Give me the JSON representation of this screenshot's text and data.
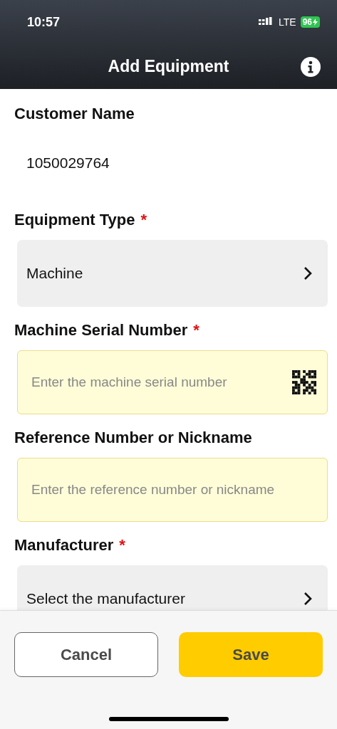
{
  "status_bar": {
    "time": "10:57",
    "network": "LTE",
    "battery": "96"
  },
  "header": {
    "title": "Add Equipment"
  },
  "fields": [
    {
      "kind": "text",
      "label": "Customer Name",
      "value": "1050029764"
    },
    {
      "kind": "select",
      "label": "Equipment Type",
      "required_mark": "*",
      "value": "Machine"
    },
    {
      "kind": "input",
      "label": "Machine Serial Number",
      "required_mark": "*",
      "placeholder": "Enter the machine serial number",
      "scan": true
    },
    {
      "kind": "input",
      "label": "Reference Number or Nickname",
      "placeholder": "Enter the reference number or nickname",
      "scan": false
    },
    {
      "kind": "select",
      "label": "Manufacturer",
      "required_mark": "*",
      "placeholder": "Select the manufacturer"
    }
  ],
  "buttons": [
    {
      "kind": "secondary",
      "label": "Cancel"
    },
    {
      "kind": "primary",
      "label": "Save"
    }
  ]
}
